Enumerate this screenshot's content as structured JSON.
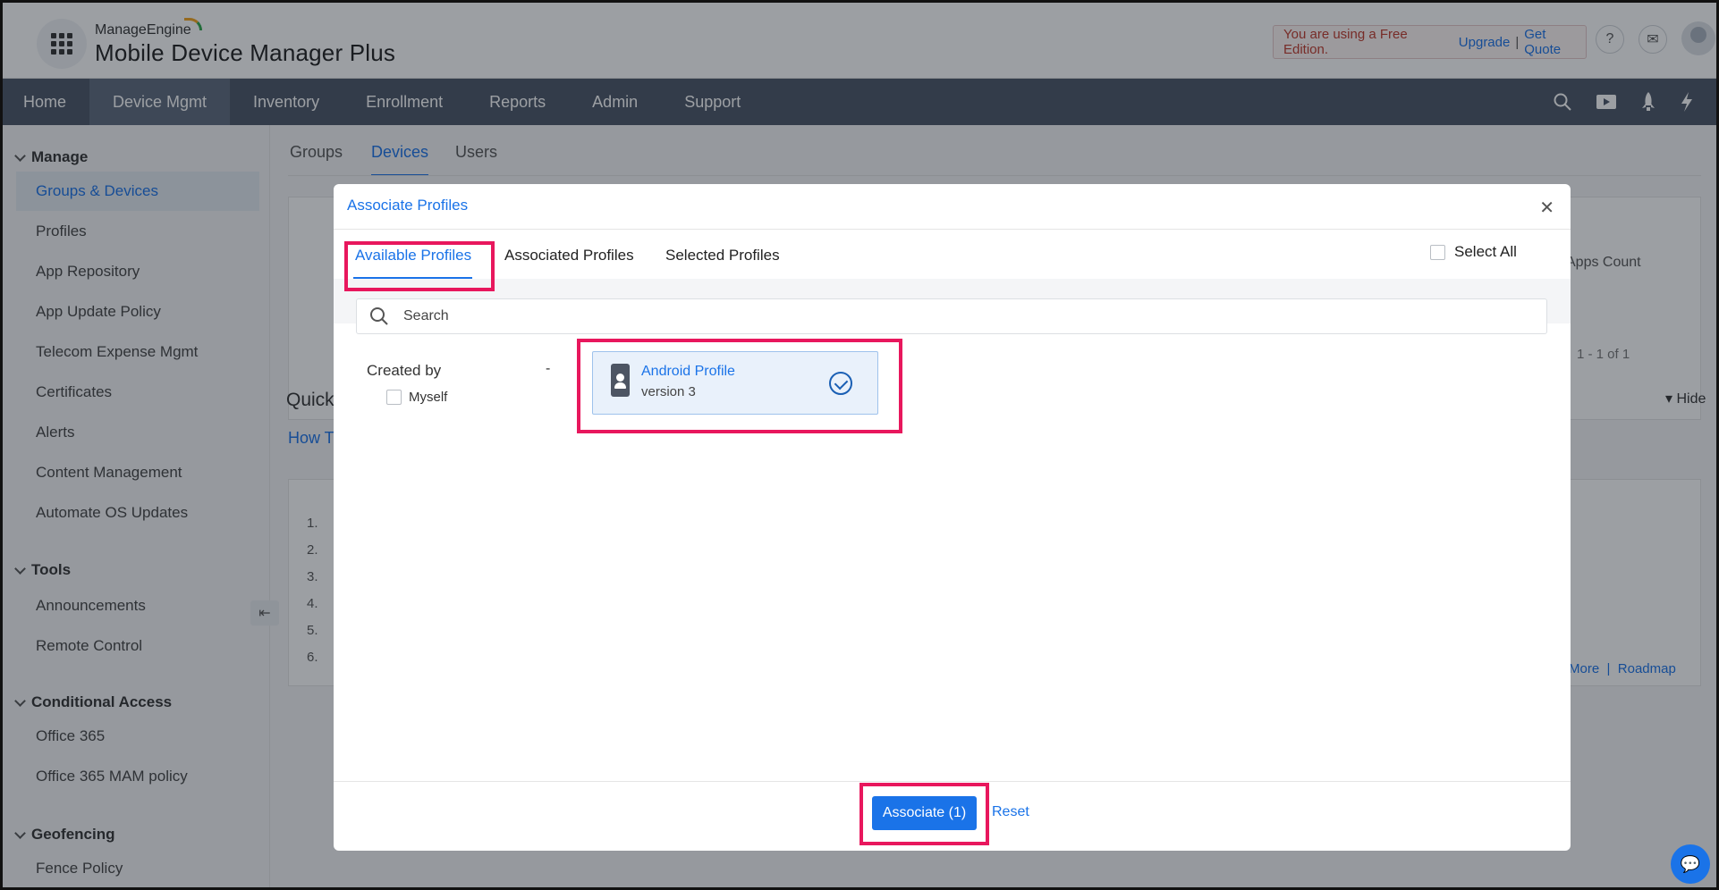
{
  "brand": {
    "vendor": "ManageEngine",
    "product": "Mobile Device Manager Plus"
  },
  "edition": {
    "text": "You are using a Free Edition.",
    "upgrade": "Upgrade",
    "separator": "|",
    "quote": "Get Quote"
  },
  "header_icons": {
    "help": "?",
    "mail": "✉"
  },
  "nav": {
    "items": [
      "Home",
      "Device Mgmt",
      "Inventory",
      "Enrollment",
      "Reports",
      "Admin",
      "Support"
    ],
    "active": "Device Mgmt"
  },
  "sidebar": {
    "sections": [
      {
        "title": "Manage",
        "items": [
          "Groups & Devices",
          "Profiles",
          "App Repository",
          "App Update Policy",
          "Telecom Expense Mgmt",
          "Certificates",
          "Alerts",
          "Content Management",
          "Automate OS Updates"
        ]
      },
      {
        "title": "Tools",
        "items": [
          "Announcements",
          "Remote Control"
        ]
      },
      {
        "title": "Conditional Access",
        "items": [
          "Office 365",
          "Office 365 MAM policy"
        ]
      },
      {
        "title": "Geofencing",
        "items": [
          "Fence Policy"
        ]
      }
    ],
    "active_item": "Groups & Devices"
  },
  "main": {
    "tabs": [
      "Groups",
      "Devices",
      "Users"
    ],
    "active_tab": "Devices",
    "apps_count_header": "Apps Count",
    "pager": "1 - 1 of 1",
    "quick_title": "Quick",
    "how_to_tab": "How T",
    "hide_label": "Hide",
    "list_numbers": [
      "1.",
      "2.",
      "3.",
      "4.",
      "5.",
      "6."
    ],
    "more_label": "More",
    "roadmap_label": "Roadmap"
  },
  "modal": {
    "title": "Associate Profiles",
    "tabs": [
      "Available Profiles",
      "Associated Profiles",
      "Selected Profiles"
    ],
    "active_tab": "Available Profiles",
    "select_all": "Select All",
    "search_placeholder": "Search",
    "filter": {
      "label": "Created by",
      "option": "Myself",
      "dash": "-"
    },
    "profiles": [
      {
        "name": "Android Profile",
        "version": "version 3",
        "selected": true
      }
    ],
    "associate_button": "Associate (1)",
    "reset_link": "Reset"
  },
  "colors": {
    "accent": "#1a73e8",
    "nav_bg": "#4a5566",
    "highlight": "#e8175d"
  }
}
